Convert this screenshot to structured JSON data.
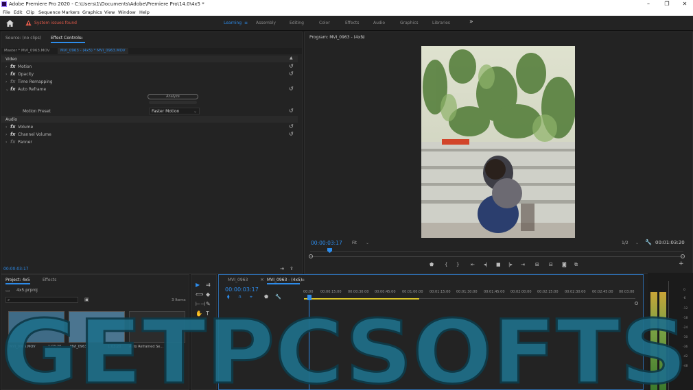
{
  "window": {
    "title": "Adobe Premiere Pro 2020 - C:\\Users\\1\\Documents\\Adobe\\Premiere Pro\\14.0\\4x5 *",
    "controls": [
      "–",
      "❐",
      "✕"
    ]
  },
  "menu": [
    "File",
    "Edit",
    "Clip",
    "Sequence",
    "Markers",
    "Graphics",
    "View",
    "Window",
    "Help"
  ],
  "workspace": {
    "warning": "System issues found",
    "tabs": [
      "Learning",
      "Assembly",
      "Editing",
      "Color",
      "Effects",
      "Audio",
      "Graphics",
      "Libraries"
    ],
    "active": "Learning",
    "more": "»"
  },
  "source_panel": {
    "tab_source": "Source: (no clips)",
    "tab_effect_controls": "Effect Controls",
    "menu_glyph": "≡",
    "master": "Master * MVI_0963.MOV",
    "sequence_clip": "MVI_0963 - (4x5) * MVI_0963.MOV",
    "video_section": "Video",
    "audio_section": "Audio",
    "effects": [
      "Motion",
      "Opacity",
      "Time Remapping",
      "Auto Reframe"
    ],
    "analyze_label": "Analyze",
    "motion_preset_label": "Motion Preset",
    "motion_preset_value": "Faster Motion",
    "audio_effects": [
      "Volume",
      "Channel Volume",
      "Panner"
    ],
    "timecode": "00:00:03:17"
  },
  "program_panel": {
    "title": "Program: MVI_0963 - (4x5)",
    "menu_glyph": "≡",
    "timecode": "00:00:03:17",
    "fit": "Fit",
    "quality": "1/2",
    "duration": "00:01:03:20"
  },
  "project_panel": {
    "tab_project": "Project: 4x5",
    "tab_effects": "Effects",
    "file": "4x5.prproj",
    "items_count": "3 Items",
    "items": [
      {
        "name": "MVI_0963.MOV",
        "duration": "1:03:20"
      },
      {
        "name": "MVI_0963",
        "duration": "1:03:20"
      },
      {
        "name": "Auto Reframed Se...",
        "duration": ""
      }
    ]
  },
  "timeline": {
    "tab_1": "MVI_0963",
    "tab_2": "MVI_0963 - (4x5)",
    "close": "×",
    "menu_glyph": "≡",
    "timecode": "00:00:03:17",
    "ruler": [
      "00:00",
      "00:00:15:00",
      "00:00:30:00",
      "00:00:45:00",
      "00:01:00:00",
      "00:01:15:00",
      "00:01:30:00",
      "00:01:45:00",
      "00:02:00:00",
      "00:02:15:00",
      "00:02:30:00",
      "00:02:45:00",
      "00:03:00"
    ]
  },
  "meter_scale": [
    "0",
    "-6",
    "-12",
    "-18",
    "-24",
    "-30",
    "-36",
    "-42",
    "-48"
  ],
  "watermark": "GETPCSOFTS",
  "colors": {
    "accent": "#2d8ceb",
    "warning": "#e05a4a",
    "panel": "#232323",
    "watermark": "#1f6f8a"
  }
}
